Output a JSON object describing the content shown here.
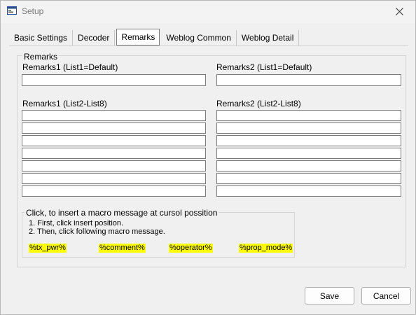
{
  "window": {
    "title": "Setup"
  },
  "tabs": [
    {
      "label": "Basic Settings",
      "active": false
    },
    {
      "label": "Decoder",
      "active": false
    },
    {
      "label": "Remarks",
      "active": true
    },
    {
      "label": "Weblog Common",
      "active": false
    },
    {
      "label": "Weblog Detail",
      "active": false
    }
  ],
  "remarks": {
    "group_label": "Remarks",
    "remarks1_default_label": "Remarks1 (List1=Default)",
    "remarks2_default_label": "Remarks2 (List1=Default)",
    "remarks1_list_label": "Remarks1 (List2-List8)",
    "remarks2_list_label": "Remarks2 (List2-List8)",
    "remarks1_default_value": "",
    "remarks2_default_value": "",
    "remarks1_list_values": [
      "",
      "",
      "",
      "",
      "",
      "",
      ""
    ],
    "remarks2_list_values": [
      "",
      "",
      "",
      "",
      "",
      "",
      ""
    ]
  },
  "macro": {
    "title": "Click, to insert a macro message at cursol possition",
    "step1": "1. First, click insert position.",
    "step2": "2. Then, click following macro message.",
    "items": [
      "%tx_pwr%",
      "%comment%",
      "%operator%",
      "%prop_mode%"
    ],
    "highlight_color": "#ffff00"
  },
  "buttons": {
    "save": "Save",
    "cancel": "Cancel"
  },
  "icons": {
    "app": "setup-window-icon",
    "close": "close-icon"
  }
}
